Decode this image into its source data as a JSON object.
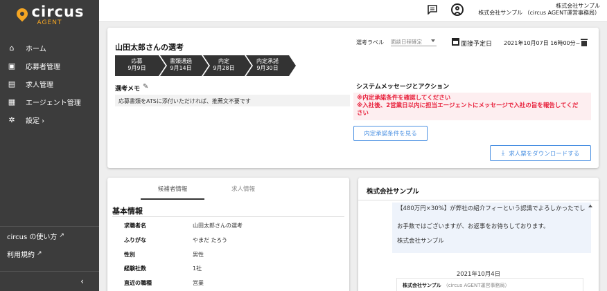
{
  "app": {
    "logo_word": "circus",
    "logo_sub": "AGENT"
  },
  "sidebar": {
    "items": [
      {
        "label": "ホーム",
        "icon": "home-icon"
      },
      {
        "label": "応募者管理",
        "icon": "applicant-icon"
      },
      {
        "label": "求人管理",
        "icon": "job-icon"
      },
      {
        "label": "エージェント管理",
        "icon": "agent-icon"
      },
      {
        "label": "設定 ›",
        "icon": "gear-icon"
      }
    ],
    "links": [
      {
        "label": "circus の使い方"
      },
      {
        "label": "利用規約"
      }
    ],
    "collapse": "‹"
  },
  "header": {
    "company": "株式会社サンプル",
    "user": "株式会社サンプル （circus AGENT運営事務局）"
  },
  "selection": {
    "title": "山田太郎さんの選考",
    "steps": [
      {
        "name": "応募",
        "date": "9月9日"
      },
      {
        "name": "書類通過",
        "date": "9月14日"
      },
      {
        "name": "内定",
        "date": "9月28日"
      },
      {
        "name": "内定承諾",
        "date": "9月30日"
      }
    ],
    "memo_label": "選考メモ",
    "memo_text": "応募書類をATSに添付いただければ、推薦文不要です",
    "label_caption": "選考ラベル",
    "label_value": "面談日程確定",
    "interview_label": "面接予定日",
    "interview_date": "2021年10月07日 16時00分~",
    "system_label": "システムメッセージとアクション",
    "alert_lines": [
      "※内定承諾条件を確認してください",
      "※入社後、2営業日以内に担当エージェントにメッセージで入社の旨を報告してくだ",
      "さい"
    ],
    "offer_button": "内定承諾条件を見る",
    "download_button": "求人票をダウンロードする"
  },
  "candidate": {
    "tabs": [
      "候補者情報",
      "求人情報"
    ],
    "section_title": "基本情報",
    "rows": [
      {
        "key": "求職者名",
        "value": "山田太郎さんの選考"
      },
      {
        "key": "ふりがな",
        "value": "やまだ たろう"
      },
      {
        "key": "性別",
        "value": "男性"
      },
      {
        "key": "経験社数",
        "value": "1社"
      },
      {
        "key": "直近の職種",
        "value": "営業"
      }
    ]
  },
  "messages": {
    "title": "株式会社サンプル",
    "bubble_lines": [
      "【480万円×30%】が弊社の紹介フィーという認識でよろしかったでし",
      "お手数ではございますが、お返事をお待ちしております。",
      "株式会社サンプル"
    ],
    "date": "2021年10月4日",
    "sender": "株式会社サンプル",
    "sender_sub": "（circus AGENT運営事務局）"
  },
  "colors": {
    "sidebar_bg": "#3c3c3c",
    "brand_orange": "#f5a623",
    "accent_blue": "#4a90e2",
    "alert_red": "#e8203b",
    "alert_bg": "#fdeef0"
  }
}
